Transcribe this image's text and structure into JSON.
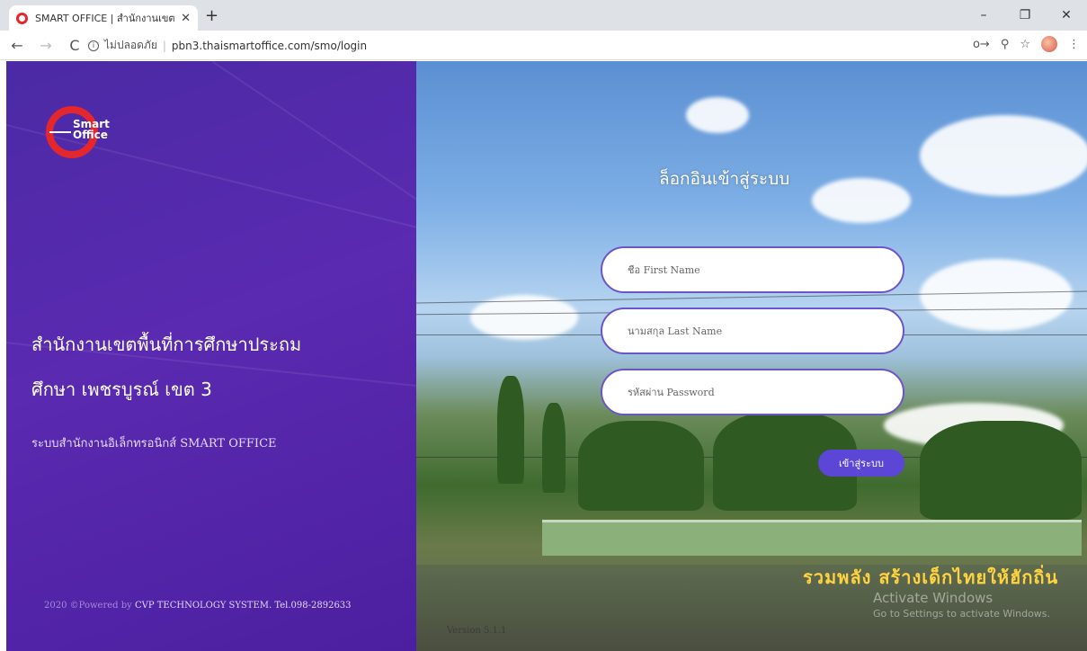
{
  "browser": {
    "tab_title": "SMART OFFICE | สำนักงานเขตพื้นที่",
    "tab_close": "✕",
    "new_tab": "+",
    "minimize": "–",
    "restore": "❐",
    "close": "✕",
    "back": "←",
    "forward": "→",
    "reload": "C",
    "info": "i",
    "security_text": "ไม่ปลอดภัย",
    "url_separator": "|",
    "url": "pbn3.thaismartoffice.com/smo/login",
    "key_icon": "o→",
    "zoom_icon": "⚲",
    "star_icon": "☆",
    "menu_icon": "⋮"
  },
  "left": {
    "logo_text_1": "Smart",
    "logo_text_2": "Office",
    "title_line_1": "สำนักงานเขตพื้นที่การศึกษาประถม",
    "title_line_2": "ศึกษา เพชรบูรณ์ เขต 3",
    "subtitle": "ระบบสำนักงานอิเล็กทรอนิกส์ SMART OFFICE",
    "footer_prefix": "2020 ©Powered by",
    "footer_brand": "CVP TECHNOLOGY SYSTEM. Tel.098-2892633"
  },
  "login": {
    "title": "ล็อกอินเข้าสู่ระบบ",
    "first_name_placeholder": "ชื่อ First Name",
    "last_name_placeholder": "นามสกุล Last Name",
    "password_placeholder": "รหัสผ่าน Password",
    "submit_label": "เข้าสู่ระบบ"
  },
  "background": {
    "sign_text": "รวมพลัง สร้างเด็กไทยให้ฮักถิ่น",
    "version": "Version 5.1.1",
    "watermark_line_1": "Activate Windows",
    "watermark_line_2": "Go to Settings to activate Windows."
  },
  "colors": {
    "panel_purple": "#4b2aa5",
    "button_purple": "#5b46d6",
    "logo_red": "#e4262d"
  }
}
